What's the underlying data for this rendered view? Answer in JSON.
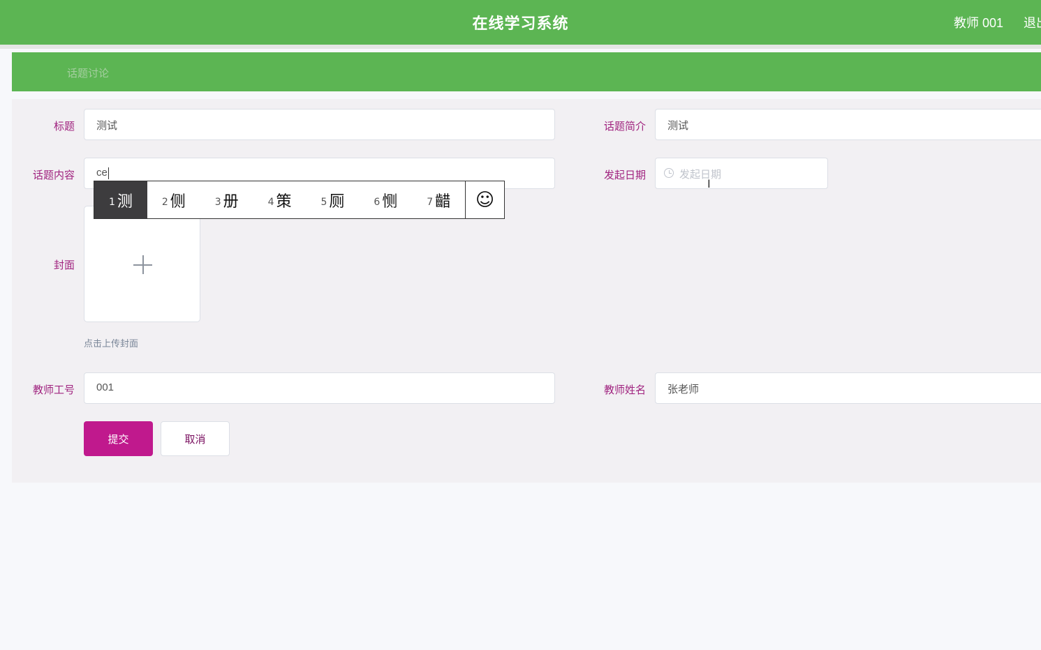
{
  "header": {
    "app_title": "在线学习系统",
    "user_label": "教师 001",
    "logout_label": "退出"
  },
  "breadcrumb": {
    "current": "话题讨论"
  },
  "form": {
    "title": {
      "label": "标题",
      "value": "测试"
    },
    "summary": {
      "label": "话题简介",
      "value": "测试"
    },
    "content": {
      "label": "话题内容",
      "value": "ce"
    },
    "start_date": {
      "label": "发起日期",
      "placeholder": "发起日期"
    },
    "cover": {
      "label": "封面",
      "tip": "点击上传封面"
    },
    "teacher_id": {
      "label": "教师工号",
      "value": "001"
    },
    "teacher_name": {
      "label": "教师姓名",
      "value": "张老师"
    },
    "submit_label": "提交",
    "cancel_label": "取消"
  },
  "ime": {
    "candidates": [
      {
        "num": "1",
        "char": "测"
      },
      {
        "num": "2",
        "char": "侧"
      },
      {
        "num": "3",
        "char": "册"
      },
      {
        "num": "4",
        "char": "策"
      },
      {
        "num": "5",
        "char": "厕"
      },
      {
        "num": "6",
        "char": "恻"
      },
      {
        "num": "7",
        "char": "齰"
      }
    ],
    "emoji": "☺",
    "selected_index": 0
  },
  "colors": {
    "header_green": "#5cb553",
    "label_magenta": "#a0237f",
    "primary_button": "#c0198d"
  }
}
